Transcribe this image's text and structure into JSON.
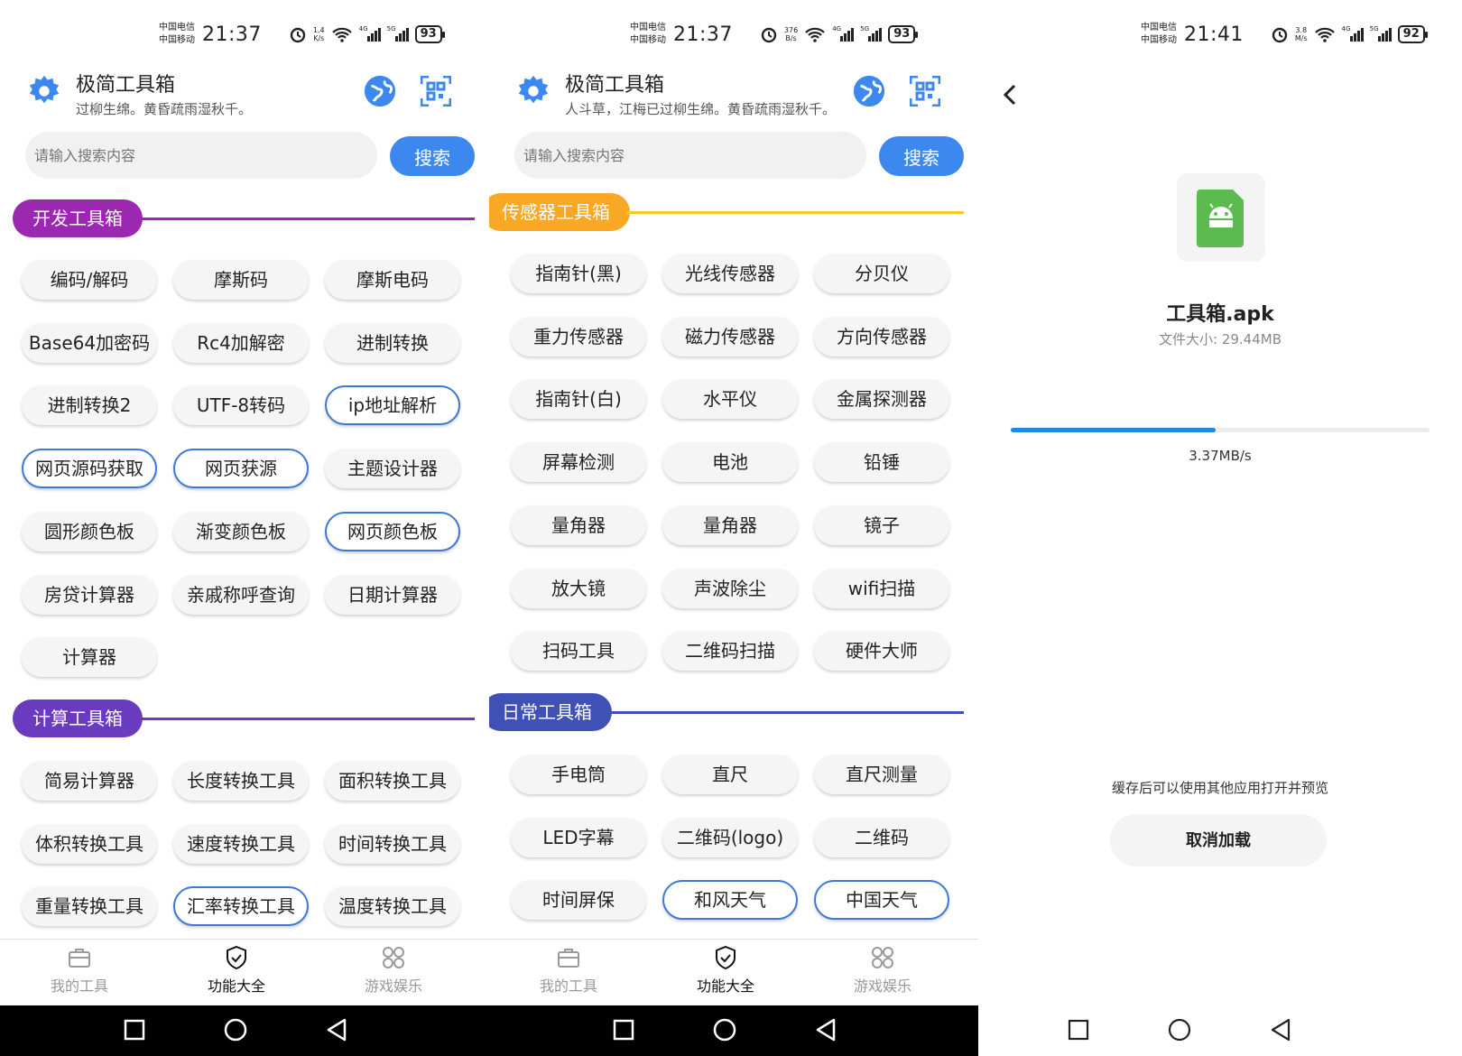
{
  "colors": {
    "accent_blue": "#3c88ee",
    "dev_purple": "#9c27b0",
    "calc_purple": "#6a3bbf",
    "sensor_orange": "#f9a825",
    "daily_indigo": "#3f51b5",
    "apk_green": "#5cbb4f"
  },
  "panel1": {
    "status": {
      "carrier1": "中国电信",
      "carrier2": "中国移动",
      "time": "21:37",
      "net_speed_val": "1.4",
      "net_speed_unit": "K/s",
      "battery": "93"
    },
    "header": {
      "title": "极简工具箱",
      "subtitle": "过柳生绵。黄昏疏雨湿秋千。"
    },
    "search": {
      "placeholder": "请输入搜索内容",
      "button": "搜索"
    },
    "section1": {
      "title": "开发工具箱",
      "items": [
        "编码/解码",
        "摩斯码",
        "摩斯电码",
        "Base64加密码",
        "Rc4加解密",
        "进制转换",
        "进制转换2",
        "UTF-8转码",
        "ip地址解析",
        "网页源码获取",
        "网页获源",
        "主题设计器",
        "圆形颜色板",
        "渐变颜色板",
        "网页颜色板",
        "房贷计算器",
        "亲戚称呼查询",
        "日期计算器",
        "计算器"
      ]
    },
    "section2": {
      "title": "计算工具箱",
      "items": [
        "简易计算器",
        "长度转换工具",
        "面积转换工具",
        "体积转换工具",
        "速度转换工具",
        "时间转换工具",
        "重量转换工具",
        "汇率转换工具",
        "温度转换工具"
      ]
    },
    "tabs": [
      "我的工具",
      "功能大全",
      "游戏娱乐"
    ]
  },
  "panel2": {
    "status": {
      "carrier1": "中国电信",
      "carrier2": "中国移动",
      "time": "21:37",
      "net_speed_val": "376",
      "net_speed_unit": "B/s",
      "battery": "93"
    },
    "header": {
      "title": "极简工具箱",
      "subtitle": "人斗草，江梅已过柳生绵。黄昏疏雨湿秋千。"
    },
    "search": {
      "placeholder": "请输入搜索内容",
      "button": "搜索"
    },
    "section1": {
      "title": "传感器工具箱",
      "items": [
        "指南针(黑)",
        "光线传感器",
        "分贝仪",
        "重力传感器",
        "磁力传感器",
        "方向传感器",
        "指南针(白)",
        "水平仪",
        "金属探测器",
        "屏幕检测",
        "电池",
        "铅锤",
        "量角器",
        "量角器",
        "镜子",
        "放大镜",
        "声波除尘",
        "wifi扫描",
        "扫码工具",
        "二维码扫描",
        "硬件大师"
      ]
    },
    "section2": {
      "title": "日常工具箱",
      "items": [
        "手电筒",
        "直尺",
        "直尺测量",
        "LED字幕",
        "二维码(logo)",
        "二维码",
        "时间屏保",
        "和风天气",
        "中国天气"
      ]
    },
    "tabs": [
      "我的工具",
      "功能大全",
      "游戏娱乐"
    ]
  },
  "panel3": {
    "status": {
      "carrier1": "中国电信",
      "carrier2": "中国移动",
      "time": "21:41",
      "net_speed_val": "3.8",
      "net_speed_unit": "M/s",
      "battery": "92"
    },
    "file_name": "工具箱.apk",
    "file_size": "文件大小:  29.44MB",
    "progress_fraction": 0.49,
    "speed": "3.37MB/s",
    "hint": "缓存后可以使用其他应用打开并预览",
    "cancel": "取消加载"
  }
}
